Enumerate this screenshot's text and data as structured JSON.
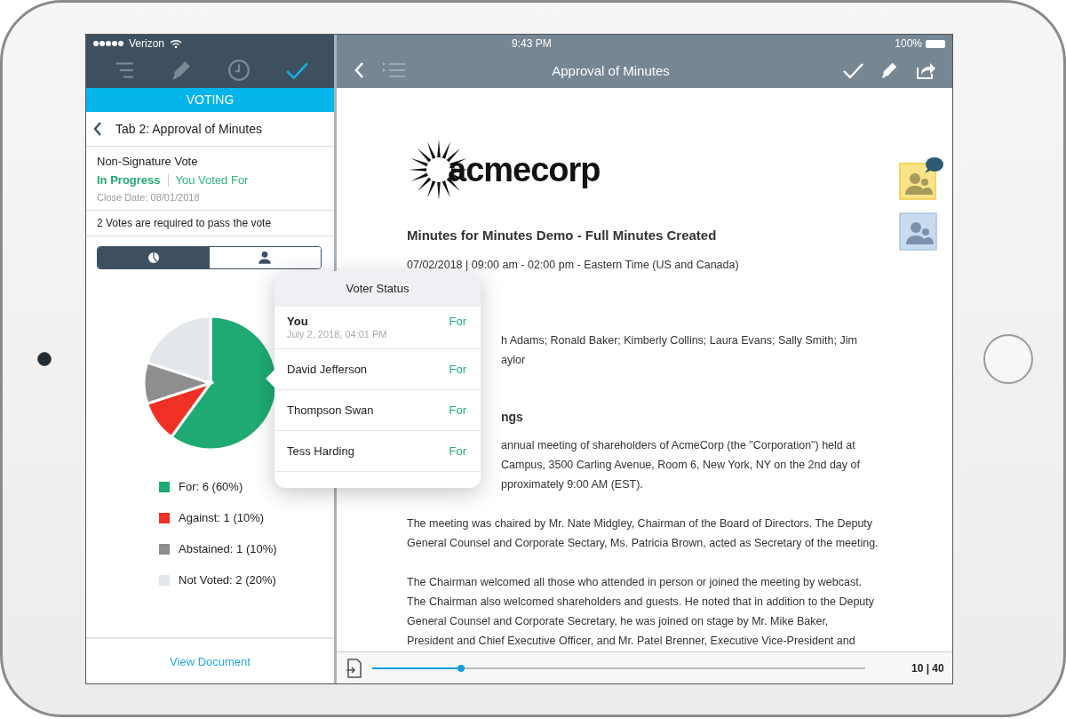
{
  "status_bar": {
    "carrier": "Verizon",
    "time": "9:43 PM",
    "battery": "100%"
  },
  "sidebar": {
    "toolbar": [
      {
        "kind": "list",
        "selected": false
      },
      {
        "kind": "pencil",
        "selected": false
      },
      {
        "kind": "clock",
        "selected": false
      },
      {
        "kind": "check",
        "selected": true
      }
    ],
    "section_title": "VOTING",
    "header": "Tab 2: Approval of Minutes",
    "vote_type": "Non-Signature Vote",
    "status": "In Progress",
    "your_vote": "You Voted For",
    "close_date": "Close Date: 08/01/2018",
    "requirement": "2 Votes are required to pass the vote",
    "view_tabs": [
      {
        "kind": "chart",
        "selected": true
      },
      {
        "kind": "person",
        "selected": false
      }
    ],
    "chart_data": {
      "type": "pie",
      "values": [
        60,
        10,
        10,
        20
      ]
    },
    "legend": [
      {
        "label": "For: 6 (60%)",
        "color": "#1eaa72"
      },
      {
        "label": "Against: 1 (10%)",
        "color": "#ee3124"
      },
      {
        "label": "Abstained: 1 (10%)",
        "color": "#8e8e8e"
      },
      {
        "label": "Not Voted: 2 (20%)",
        "color": "#e3e7eb"
      }
    ],
    "footer_link": "View Document"
  },
  "popover": {
    "title": "Voter Status",
    "voters": [
      {
        "name": "You",
        "date": "July 2, 2018, 04:01 PM",
        "vote": "For"
      },
      {
        "name": "David Jefferson",
        "vote": "For"
      },
      {
        "name": "Thompson Swan",
        "vote": "For"
      },
      {
        "name": "Tess Harding",
        "vote": "For"
      }
    ]
  },
  "document_toolbar": {
    "title": "Approval of Minutes"
  },
  "document": {
    "logo_text": "acmecorp",
    "title": "Minutes for Minutes Demo - Full Minutes Created",
    "meta": "07/02/2018 | 09:00 am - 02:00 pm - Eastern Time (US and Canada)",
    "blocks": [
      {
        "kind": "fragment",
        "lines": [
          "h Adams; Ronald Baker; Kimberly Collins; Laura Evans; Sally Smith; Jim",
          "aylor"
        ]
      },
      {
        "kind": "heading",
        "lines": [
          "ngs"
        ]
      },
      {
        "kind": "fragment",
        "lines": [
          "annual meeting of shareholders of AcmeCorp (the \"Corporation\") held at",
          "Campus, 3500 Carling Avenue, Room 6, New York, NY on the 2nd day of",
          "pproximately 9:00 AM (EST)."
        ]
      },
      {
        "kind": "paragraph",
        "lines": [
          "The meeting was chaired by Mr. Nate Midgley, Chairman of the Board of Directors. The Deputy\nGeneral Counsel and Corporate Sectary, Ms. Patricia Brown, acted as Secretary of the meeting."
        ]
      },
      {
        "kind": "paragraph",
        "lines": [
          "The Chairman welcomed all those who attended in person or joined the meeting by webcast.\nThe Chairman also welcomed shareholders and guests. He noted that in addition to the Deputy\nGeneral Counsel and Corporate Secretary, he was joined on stage by Mr. Mike Baker,\nPresident and Chief Executive Officer, and Mr. Patel Brenner, Executive Vice-President and"
        ]
      }
    ]
  },
  "pager": {
    "level": 0.18,
    "page": "10 | 40"
  }
}
